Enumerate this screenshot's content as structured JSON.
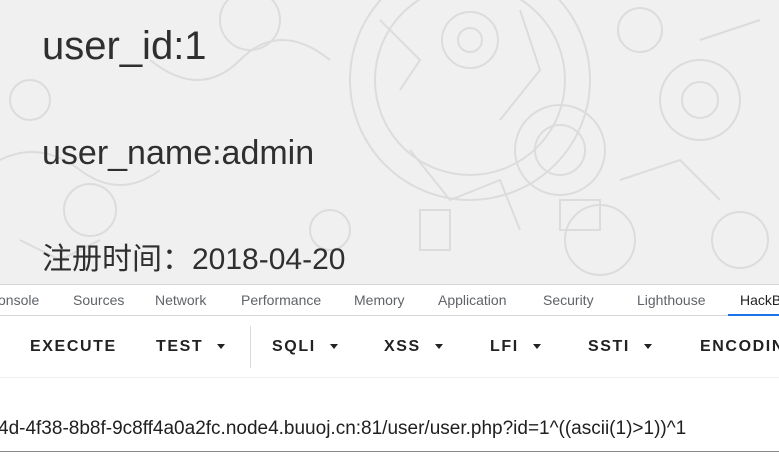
{
  "profile": {
    "user_id": "user_id:1",
    "user_name": "user_name:admin",
    "register_time": "注册时间：2018-04-20"
  },
  "devtools": {
    "tabs": [
      "onsole",
      "Sources",
      "Network",
      "Performance",
      "Memory",
      "Application",
      "Security",
      "Lighthouse",
      "HackB"
    ],
    "active_tab": "HackB",
    "accent_color": "#1a73e8"
  },
  "hackbar": {
    "buttons": {
      "execute": "EXECUTE",
      "test": "TEST",
      "sqli": "SQLI",
      "xss": "XSS",
      "lfi": "LFI",
      "ssti": "SSTI",
      "encoding": "ENCODIN"
    },
    "url": "4d-4f38-8b8f-9c8ff4a0a2fc.node4.buuoj.cn:81/user/user.php?id=1^((ascii(1)>1))^1"
  }
}
